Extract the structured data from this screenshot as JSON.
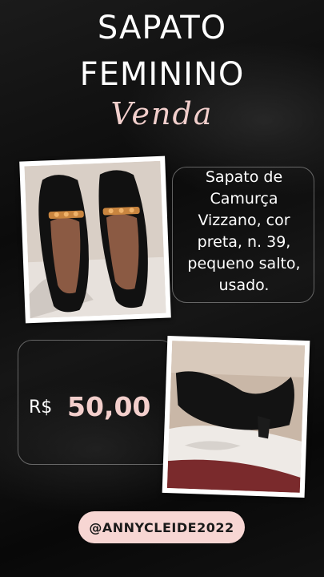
{
  "title": {
    "line1": "SAPATO",
    "line2": "FEMININO"
  },
  "subtitle": "Venda",
  "description": "Sapato de Camurça Vizzano, cor preta, n. 39, pequeno salto, usado.",
  "price": {
    "currency": "R$",
    "value": "50,00"
  },
  "handle": "@ANNYCLEIDE2022",
  "colors": {
    "accent": "#f3cfcc",
    "badge_bg": "#f7d6d3",
    "background": "#0d0d0d"
  }
}
